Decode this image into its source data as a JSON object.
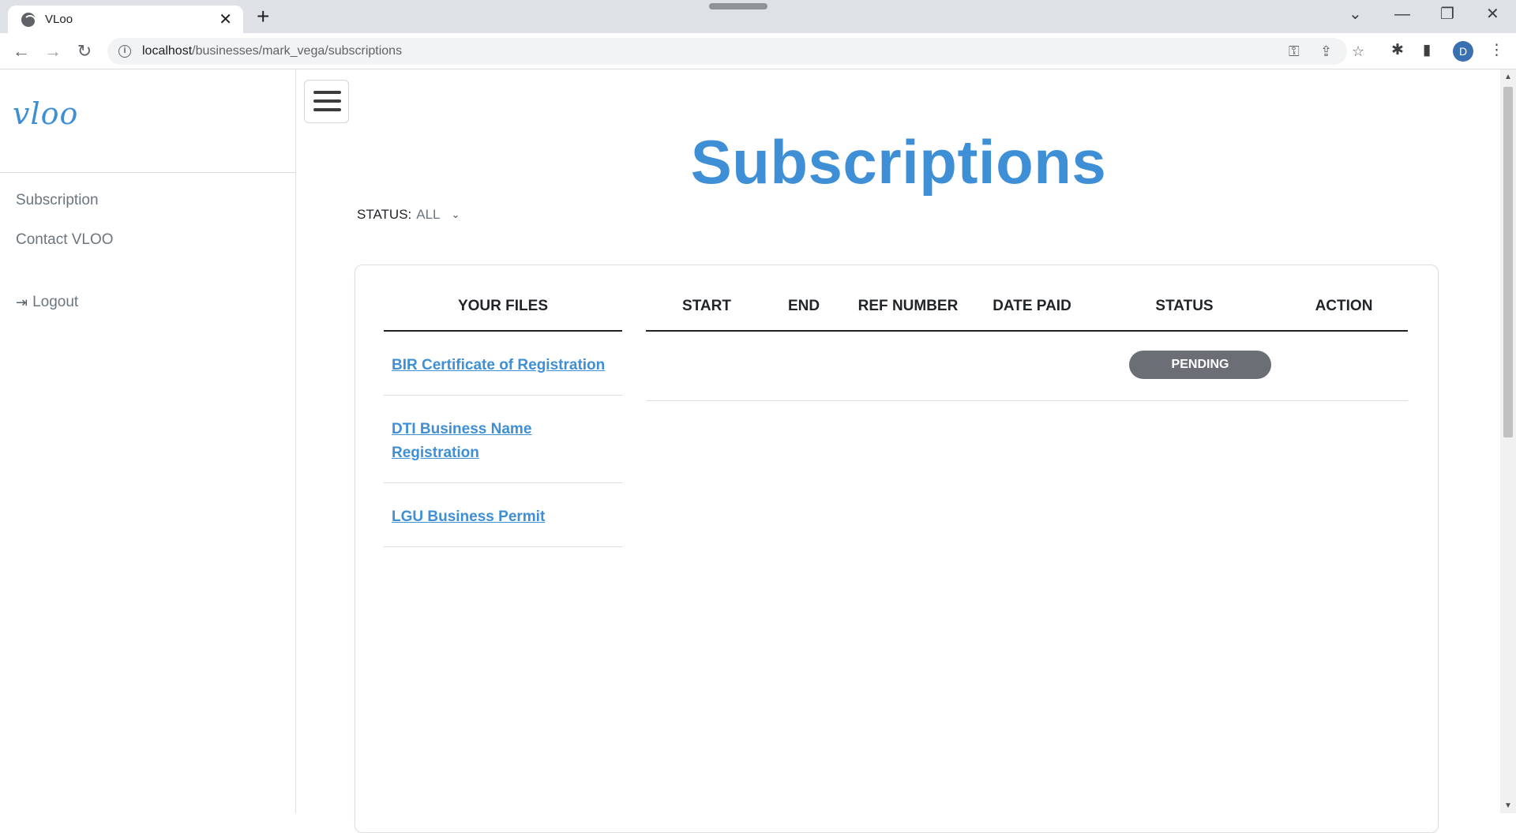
{
  "browser": {
    "tab_title": "VLoo",
    "tab_close": "✕",
    "new_tab": "+",
    "url_host": "localhost",
    "url_path": "/businesses/mark_vega/subscriptions",
    "profile_initial": "D",
    "icons": {
      "back": "←",
      "forward": "→",
      "reload": "↻",
      "info": "i",
      "key": "⚿",
      "share": "⇪",
      "star": "☆",
      "extensions": "✱",
      "sidepanel": "▮",
      "menu": "⋮",
      "tab_search": "⌄",
      "minimize": "—",
      "restore": "❐",
      "close": "✕"
    }
  },
  "sidebar": {
    "logo": "vloo",
    "items": [
      {
        "label": "Subscription"
      },
      {
        "label": "Contact VLOO"
      }
    ],
    "logout_label": "Logout",
    "logout_icon": "⇥"
  },
  "main": {
    "title": "Subscriptions",
    "status_filter": {
      "label": "STATUS:",
      "value": "ALL",
      "chevron": "⌄"
    },
    "files": {
      "header": "YOUR FILES",
      "items": [
        {
          "label": "BIR Certificate of Registration"
        },
        {
          "label": "DTI Business Name Registration"
        },
        {
          "label": "LGU Business Permit"
        }
      ]
    },
    "table": {
      "columns": [
        "START",
        "END",
        "REF NUMBER",
        "DATE PAID",
        "STATUS",
        "ACTION"
      ],
      "rows": [
        {
          "start": "",
          "end": "",
          "ref_number": "",
          "date_paid": "",
          "status": "PENDING",
          "action": ""
        }
      ]
    }
  },
  "colors": {
    "accent": "#3e8fd6",
    "badge_pending": "#6b6e75"
  }
}
